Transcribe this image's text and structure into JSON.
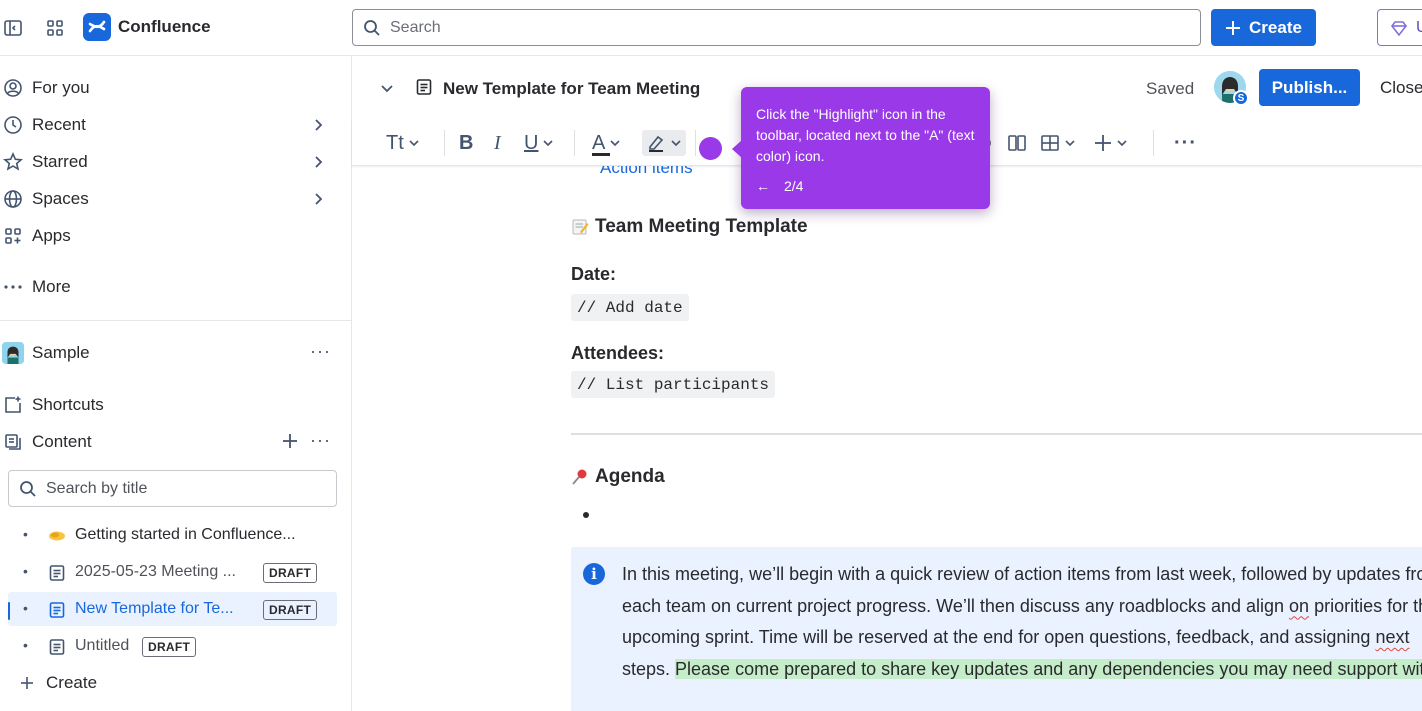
{
  "app": {
    "name": "Confluence"
  },
  "topbar": {
    "search_placeholder": "Search",
    "create_label": "Create",
    "premium_label": "U"
  },
  "sidebar": {
    "nav": [
      {
        "label": "For you",
        "icon": "user-circle-icon"
      },
      {
        "label": "Recent",
        "icon": "clock-icon"
      },
      {
        "label": "Starred",
        "icon": "star-icon"
      },
      {
        "label": "Spaces",
        "icon": "globe-icon"
      },
      {
        "label": "Apps",
        "icon": "apps-icon"
      },
      {
        "label": "More",
        "icon": "more-icon"
      }
    ],
    "space_name": "Sample",
    "shortcuts_label": "Shortcuts",
    "content_label": "Content",
    "title_search_placeholder": "Search by title",
    "tree": [
      {
        "label": "Getting started in Confluence...",
        "draft": ""
      },
      {
        "label": "2025-05-23 Meeting ...",
        "draft": "DRAFT"
      },
      {
        "label": "New Template for Te...",
        "draft": "DRAFT"
      },
      {
        "label": "Untitled",
        "draft": "DRAFT"
      }
    ],
    "create_label": "Create"
  },
  "editor": {
    "title": "New Template for Team Meeting",
    "saved_label": "Saved",
    "avatar_badge": "S",
    "publish_label": "Publish...",
    "close_label": "Close",
    "toolbar": {
      "text_style": "Tt",
      "bold": "B",
      "italic": "I",
      "underline": "U",
      "text_color": "A",
      "more": "···"
    }
  },
  "content": {
    "hidden_link": "Action items",
    "heading": "Team Meeting Template",
    "date_label": "Date:",
    "date_value": "// Add date",
    "attendees_label": "Attendees:",
    "attendees_value": "// List participants",
    "agenda_heading": "Agenda",
    "info": {
      "part1": "In this meeting, we’ll begin with a quick review of action items from last week, followed by updates from each team on current project progress. We’ll then discuss any roadblocks and align ",
      "on": "on",
      "part2": " priorities for the upcoming sprint. Time will be reserved at the end for open questions, feedback, and assigning ",
      "next": "next",
      "part3": " steps. ",
      "highlighted": "Please come prepared to share key updates and any dependencies you may need support with."
    }
  },
  "tooltip": {
    "text": "Click the \"Highlight\" icon in the toolbar, located next to the \"A\" (text color) icon.",
    "back": "←",
    "step": "2/4"
  },
  "colors": {
    "brand": "#1868db",
    "tooltip": "#9a39e8",
    "highlight": "#c6edc9",
    "info_panel": "#e9f2fe"
  }
}
